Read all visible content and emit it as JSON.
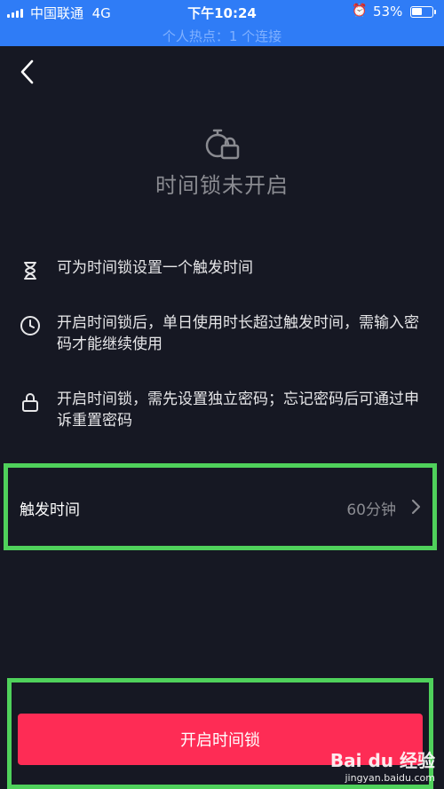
{
  "status_bar": {
    "carrier": "中国联通",
    "network": "4G",
    "time": "下午10:24",
    "battery_percent": "53%",
    "battery_level": 0.53,
    "hotspot_text": "个人热点：1 个连接"
  },
  "header": {
    "status_title": "时间锁未开启"
  },
  "features": [
    {
      "icon": "hourglass-icon",
      "text": "可为时间锁设置一个触发时间"
    },
    {
      "icon": "clock-icon",
      "text": "开启时间锁后，单日使用时长超过触发时间，需输入密码才能继续使用"
    },
    {
      "icon": "lock-icon",
      "text": "开启时间锁，需先设置独立密码；忘记密码后可通过申诉重置密码"
    }
  ],
  "trigger": {
    "label": "触发时间",
    "value": "60分钟"
  },
  "cta": {
    "label": "开启时间锁"
  },
  "watermark": {
    "logo": "Bai du 经验",
    "url": "jingyan.baidu.com"
  },
  "colors": {
    "background": "#161823",
    "status_bar": "#2f7cf6",
    "primary": "#fe2c55",
    "highlight": "#4fd15b"
  }
}
